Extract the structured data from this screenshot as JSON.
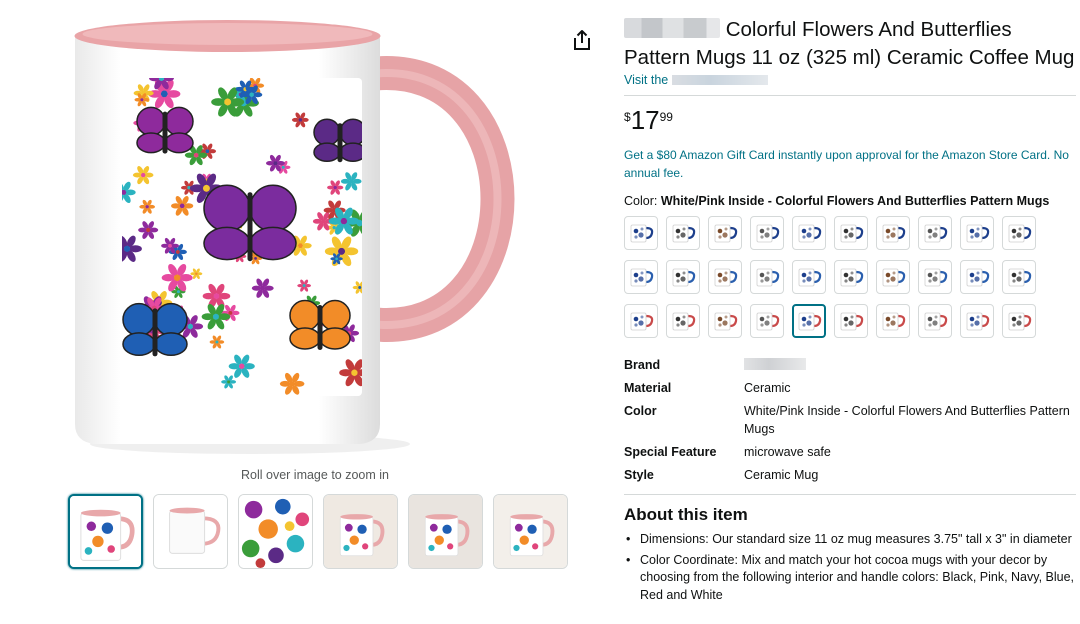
{
  "product": {
    "title_rest": "Colorful Flowers And Butterflies Pattern Mugs 11 oz (325 ml) Ceramic Coffee Mug",
    "store_prefix": "Visit the",
    "price_symbol": "$",
    "price_whole": "17",
    "price_fraction": "99",
    "promo": "Get a $80 Amazon Gift Card instantly upon approval for the Amazon Store Card. No annual fee."
  },
  "media": {
    "zoom_hint": "Roll over image to zoom in",
    "thumbnail_count": 6,
    "selected_thumbnail": 1
  },
  "color": {
    "label": "Color:",
    "selected_name": "White/Pink Inside - Colorful Flowers And Butterflies Pattern Mugs",
    "swatch_rows": 3,
    "swatch_cols": 10,
    "selected_swatch": 25,
    "row_accents": [
      "#1d3f8c",
      "#2a5fae",
      "#c94a4a"
    ]
  },
  "specs": [
    {
      "key": "Brand",
      "value": ""
    },
    {
      "key": "Material",
      "value": "Ceramic"
    },
    {
      "key": "Color",
      "value": "White/Pink Inside - Colorful Flowers And Butterflies Pattern Mugs"
    },
    {
      "key": "Special Feature",
      "value": "microwave safe"
    },
    {
      "key": "Style",
      "value": "Ceramic Mug"
    }
  ],
  "about": {
    "title": "About this item",
    "bullets": [
      "Dimensions: Our standard size 11 oz mug measures 3.75\" tall x 3\" in diameter",
      "Color Coordinate: Mix and match your hot cocoa mugs with your decor by choosing from the following interior and handle colors: Black, Pink, Navy, Blue, Red and White"
    ]
  },
  "colors": {
    "link": "#007185",
    "mug_pink": "#e8a8aa",
    "selected_border": "#007185"
  }
}
